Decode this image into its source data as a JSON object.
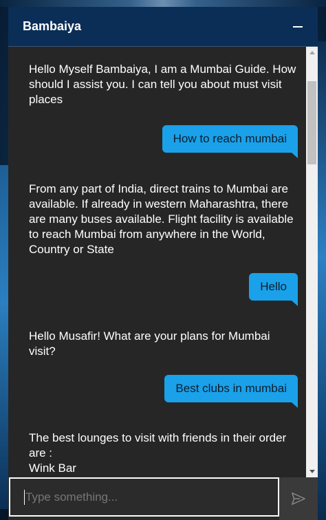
{
  "chat": {
    "title": "Bambaiya",
    "messages": [
      {
        "role": "bot",
        "text": "Hello Myself Bambaiya, I am a Mumbai Guide. How should I assist you. I can tell you about must visit places"
      },
      {
        "role": "user",
        "text": "How to reach mumbai"
      },
      {
        "role": "bot",
        "text": "From any part of India, direct trains to Mumbai are available. If already in western Maharashtra, there are many buses available. Flight facility is available to reach Mumbai from anywhere in the World, Country or State"
      },
      {
        "role": "user",
        "text": "Hello"
      },
      {
        "role": "bot",
        "text": "Hello Musafir! What are your plans for Mumbai visit?"
      },
      {
        "role": "user",
        "text": "Best clubs in mumbai"
      },
      {
        "role": "bot",
        "text": "The best lounges to visit with friends in their order are :"
      },
      {
        "role": "bot",
        "text": "Wink Bar"
      }
    ],
    "input": {
      "placeholder": "Type something...",
      "value": ""
    },
    "icons": {
      "minimize": "minimize-icon",
      "send": "send-icon"
    },
    "colors": {
      "header": "#0b2e57",
      "user_bubble": "#1aa1ea",
      "chat_bg": "#262626"
    }
  }
}
